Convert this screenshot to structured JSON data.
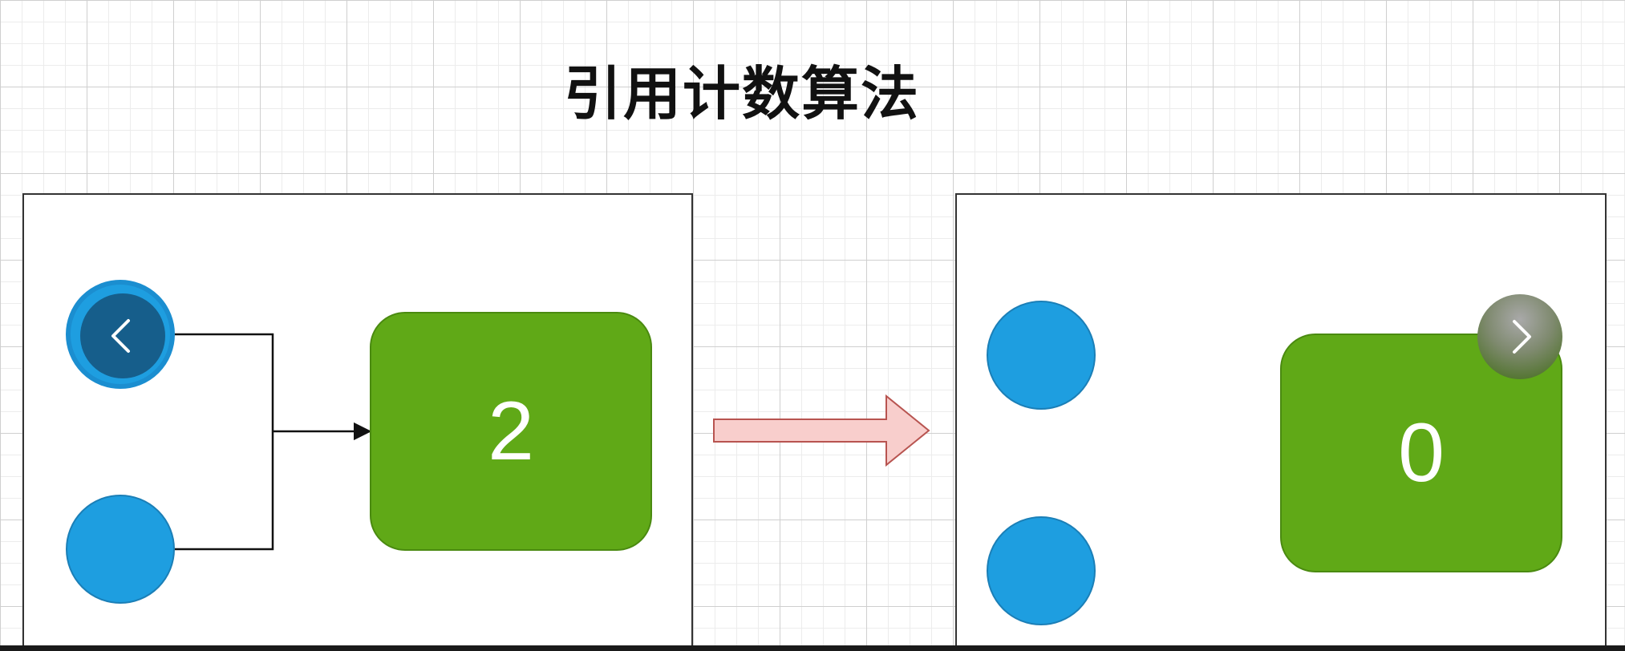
{
  "diagram": {
    "title": "引用计数算法",
    "before": {
      "count": "2"
    },
    "after": {
      "count": "0"
    }
  },
  "colors": {
    "object_fill": "#1e9ee0",
    "counter_fill": "#60a917",
    "transition_arrow_fill": "#f8cecc",
    "transition_arrow_stroke": "#b85450",
    "carousel_prev": "#144b73",
    "carousel_next": "#3f6b14"
  },
  "icons": {
    "prev": "chevron-left-icon",
    "next": "chevron-right-icon"
  }
}
